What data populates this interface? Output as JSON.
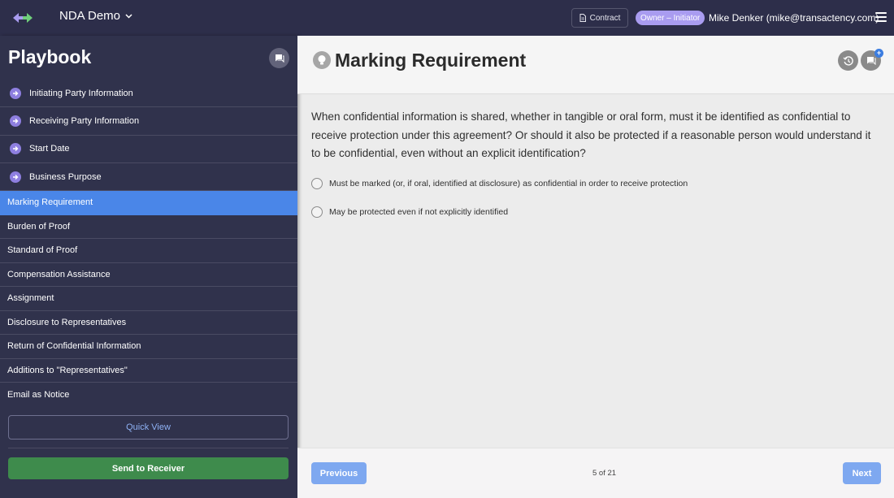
{
  "colors": {
    "topbar": "#2d2e4a",
    "sidebar": "#30324c",
    "active_item": "#4a86e8",
    "role_badge": "#a99cf0",
    "send_button": "#3e8b4c",
    "nav_buttons": "#7ea8f0",
    "done_icon": "#8e7fe0"
  },
  "header": {
    "logo_icon": "arrows-logo-icon",
    "document_title": "NDA Demo",
    "contract_label": "Contract",
    "role_badge": "Owner – Initiator",
    "user": "Mike Denker (mike@transactency.com)",
    "menu_icon": "hamburger-icon"
  },
  "sidebar": {
    "title": "Playbook",
    "chat_icon": "chat-icon",
    "items": [
      {
        "label": "Initiating Party Information",
        "state": "done"
      },
      {
        "label": "Receiving Party Information",
        "state": "done"
      },
      {
        "label": "Start Date",
        "state": "done"
      },
      {
        "label": "Business Purpose",
        "state": "done"
      },
      {
        "label": "Marking Requirement",
        "state": "active"
      },
      {
        "label": "Burden of Proof",
        "state": "todo"
      },
      {
        "label": "Standard of Proof",
        "state": "todo"
      },
      {
        "label": "Compensation Assistance",
        "state": "todo"
      },
      {
        "label": "Assignment",
        "state": "todo"
      },
      {
        "label": "Disclosure to Representatives",
        "state": "todo"
      },
      {
        "label": "Return of Confidential Information",
        "state": "todo"
      },
      {
        "label": "Additions to \"Representatives\"",
        "state": "todo"
      },
      {
        "label": "Email as Notice",
        "state": "todo"
      }
    ],
    "quick_view": "Quick View",
    "send_button": "Send to Receiver"
  },
  "main": {
    "title": "Marking Requirement",
    "question": "When confidential information is shared, whether in tangible or oral form, must it be identified as confidential to receive protection under this agreement? Or should it also be protected if a reasonable person would understand it to be confidential, even without an explicit identification?",
    "options": [
      "Must be marked (or, if oral, identified at disclosure) as confidential in order to receive protection",
      "May be protected even if not explicitly identified"
    ],
    "history_icon": "history-icon",
    "comment_icon": "comment-icon",
    "badge_plus": "+"
  },
  "footer": {
    "previous": "Previous",
    "page_indicator": "5 of 21",
    "next": "Next"
  }
}
